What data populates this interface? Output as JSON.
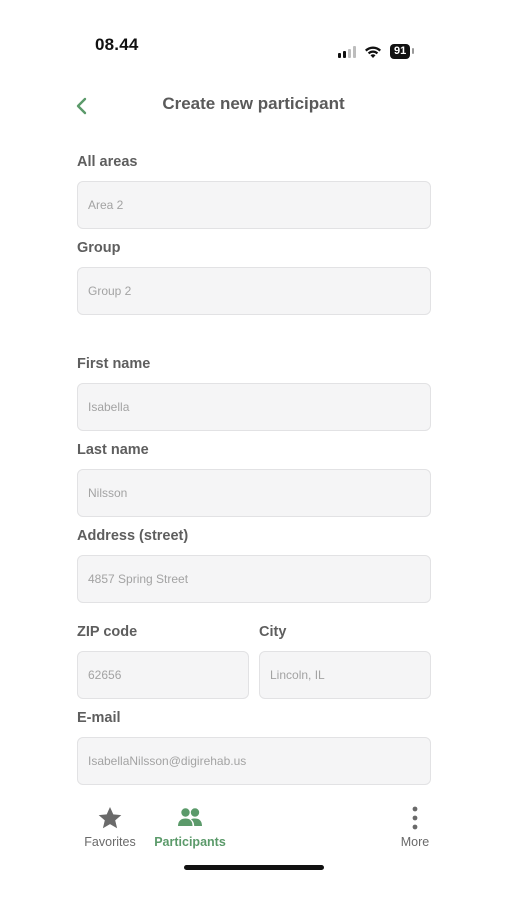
{
  "status_bar": {
    "time": "08.44",
    "battery": "91"
  },
  "header": {
    "back_icon": "chevron-left-icon",
    "title": "Create new participant",
    "accent_color": "#5b9a6a"
  },
  "form": {
    "area": {
      "label": "All areas",
      "value": "Area 2"
    },
    "group": {
      "label": "Group",
      "value": "Group 2"
    },
    "first_name": {
      "label": "First name",
      "value": "Isabella"
    },
    "last_name": {
      "label": "Last name",
      "value": "Nilsson"
    },
    "address": {
      "label": "Address (street)",
      "value": "4857 Spring Street"
    },
    "zip": {
      "label": "ZIP code",
      "value": "62656"
    },
    "city": {
      "label": "City",
      "value": "Lincoln, IL"
    },
    "email": {
      "label": "E-mail",
      "value": "IsabellaNilsson@digirehab.us"
    }
  },
  "bottom_nav": {
    "items": [
      {
        "label": "Favorites",
        "icon": "star-icon",
        "active": false
      },
      {
        "label": "Participants",
        "icon": "people-icon",
        "active": true
      },
      {
        "label": "More",
        "icon": "more-vertical-icon",
        "active": false
      }
    ]
  }
}
